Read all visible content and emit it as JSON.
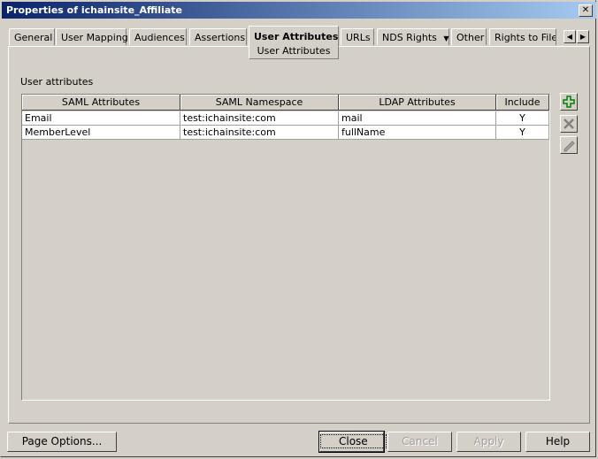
{
  "window": {
    "title": "Properties of ichainsite_Affiliate",
    "close_glyph": "✕"
  },
  "tabs": [
    {
      "label": "General"
    },
    {
      "label": "User Mapping"
    },
    {
      "label": "Audiences"
    },
    {
      "label": "Assertions"
    },
    {
      "label": "User Attributes"
    },
    {
      "label": "URLs"
    },
    {
      "label": "NDS Rights"
    },
    {
      "label": "Other"
    },
    {
      "label": "Rights to Files"
    }
  ],
  "tab_dropdown_glyph": "▼",
  "tab_scroll": {
    "left": "◀",
    "right": "▶"
  },
  "active_subtab": "User Attributes",
  "section_label": "User attributes",
  "table": {
    "columns": [
      "SAML Attributes",
      "SAML Namespace",
      "LDAP Attributes",
      "Include"
    ],
    "rows": [
      [
        "Email",
        "test:ichainsite:com",
        "mail",
        "Y"
      ],
      [
        "MemberLevel",
        "test:ichainsite:com",
        "fullName",
        "Y"
      ]
    ]
  },
  "side_buttons": {
    "add": "add-icon",
    "delete": "delete-icon",
    "edit": "edit-icon"
  },
  "colors": {
    "titlebar_start": "#0a246a",
    "titlebar_end": "#a6caf0",
    "add_icon": "#008000",
    "panel": "#d4d0c8"
  },
  "buttons": {
    "page_options": "Page Options...",
    "close": "Close",
    "cancel": "Cancel",
    "apply": "Apply",
    "help": "Help"
  }
}
